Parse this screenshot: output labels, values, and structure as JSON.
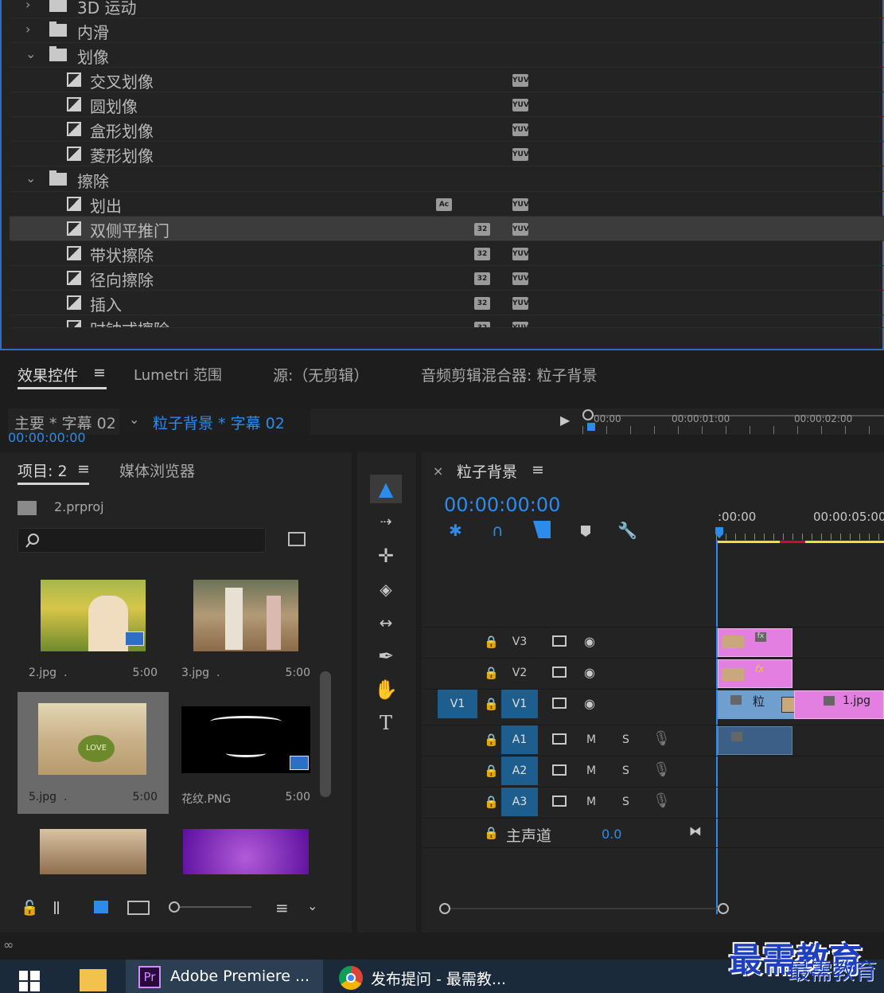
{
  "effects_tree": {
    "rows": [
      {
        "label": "3D 运动",
        "kind": "folder",
        "expanded": false
      },
      {
        "label": "内滑",
        "kind": "folder",
        "expanded": false
      },
      {
        "label": "划像",
        "kind": "folder",
        "expanded": true
      },
      {
        "label": "交叉划像",
        "kind": "item"
      },
      {
        "label": "圆划像",
        "kind": "item"
      },
      {
        "label": "盒形划像",
        "kind": "item"
      },
      {
        "label": "菱形划像",
        "kind": "item"
      },
      {
        "label": "擦除",
        "kind": "folder",
        "expanded": true
      },
      {
        "label": "划出",
        "kind": "item"
      },
      {
        "label": "双侧平推门",
        "kind": "item",
        "selected": true
      },
      {
        "label": "带状擦除",
        "kind": "item"
      },
      {
        "label": "径向擦除",
        "kind": "item"
      },
      {
        "label": "插入",
        "kind": "item"
      },
      {
        "label": "时钟式擦除",
        "kind": "item"
      }
    ],
    "badge_yuv": "YUV",
    "badge_32": "32",
    "badge_acc": "Ac"
  },
  "effect_controls": {
    "tabs": [
      "效果控件",
      "Lumetri 范围",
      "源:（无剪辑）",
      "音频剪辑混合器: 粒子背景"
    ],
    "menu_glyph": "≡",
    "master_clip": "主要 * 字幕 02",
    "sequence_clip": "粒子背景 * 字幕 02",
    "timecode": "00:00:00:00",
    "ruler_labels": [
      "00:00",
      "00:00:01:00",
      "00:00:02:00"
    ]
  },
  "project": {
    "tabs": [
      "项目: 2",
      "媒体浏览器"
    ],
    "project_file": "2.prproj",
    "search_placeholder": "",
    "items": [
      {
        "name": "2.jpg",
        "dot": ".",
        "duration": "5:00"
      },
      {
        "name": "3.jpg",
        "dot": ".",
        "duration": "5:00"
      },
      {
        "name": "5.jpg",
        "dot": ".",
        "duration": "5:00",
        "selected": true
      },
      {
        "name": "花纹.PNG",
        "dot": "",
        "duration": "5:00"
      },
      {
        "name": "",
        "dot": "",
        "duration": ""
      },
      {
        "name": "",
        "dot": "",
        "duration": ""
      }
    ],
    "love_text": "LOVE"
  },
  "tools": [
    "selection",
    "track-select",
    "ripple-edit",
    "razor",
    "slip",
    "pen",
    "hand",
    "type"
  ],
  "timeline": {
    "close_glyph": "×",
    "sequence_name": "粒子背景",
    "timecode": "00:00:00:00",
    "ruler_labels": [
      ":00:00",
      "00:00:05:00"
    ],
    "tracks": {
      "video": [
        {
          "source": "",
          "name": "V3"
        },
        {
          "source": "",
          "name": "V2"
        },
        {
          "source": "V1",
          "name": "V1"
        }
      ],
      "audio": [
        {
          "name": "A1",
          "m": "M",
          "s": "S"
        },
        {
          "name": "A2",
          "m": "M",
          "s": "S"
        },
        {
          "name": "A3",
          "m": "M",
          "s": "S"
        }
      ],
      "master_label": "主声道",
      "master_value": "0.0"
    },
    "clips": {
      "v1_label": "粒",
      "v1b_label": "1.jpg",
      "fx": "fx"
    }
  },
  "taskbar": {
    "apps": [
      {
        "label": "Adobe Premiere ...",
        "badge": "Pr"
      },
      {
        "label": "发布提问 - 最需教..."
      }
    ],
    "watermark": "最需教育"
  },
  "colors": {
    "accent_blue": "#2d8ceb",
    "clip_pink": "#e27fe0",
    "clip_blue": "#6f9fcf",
    "track_on": "#1d5e8e",
    "ruler_yellow": "#e8e23a",
    "ruler_red": "#c8102e"
  }
}
